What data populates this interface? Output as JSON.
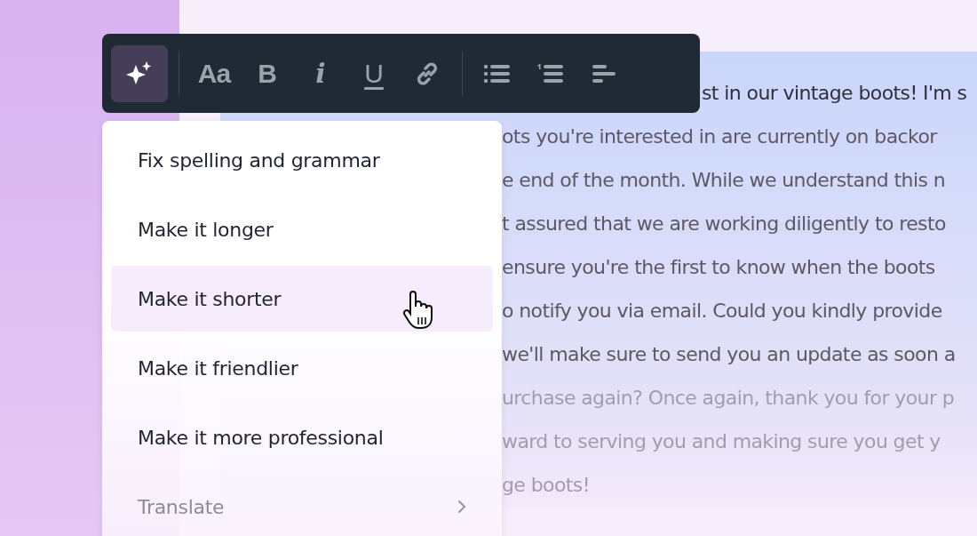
{
  "toolbar": {
    "items": [
      {
        "kind": "ai",
        "selected": true
      },
      {
        "kind": "text-style",
        "label": "Aa"
      },
      {
        "kind": "bold",
        "label": "B"
      },
      {
        "kind": "italic",
        "label": "i"
      },
      {
        "kind": "underline",
        "label": "U"
      },
      {
        "kind": "link"
      },
      {
        "kind": "divider"
      },
      {
        "kind": "bullet-list"
      },
      {
        "kind": "numbered-list"
      },
      {
        "kind": "align"
      }
    ]
  },
  "menu": {
    "items": [
      {
        "label": "Fix spelling and grammar",
        "selected": false,
        "submenu": false,
        "disabled": false
      },
      {
        "label": "Make it longer",
        "selected": false,
        "submenu": false,
        "disabled": false
      },
      {
        "label": "Make it shorter",
        "selected": true,
        "submenu": false,
        "disabled": false
      },
      {
        "label": "Make it friendlier",
        "selected": false,
        "submenu": false,
        "disabled": false
      },
      {
        "label": "Make it more professional",
        "selected": false,
        "submenu": false,
        "disabled": false
      },
      {
        "label": "Translate",
        "selected": false,
        "submenu": true,
        "disabled": true
      }
    ]
  },
  "document": {
    "lines": [
      "st in our vintage boots! I'm s",
      "ots you're interested in are currently on backor",
      "e end of the month. While we understand this n",
      "t assured that we are working diligently to resto",
      " ensure you're the first to know when the boots",
      "o notify you via email. Could you kindly provide",
      "we'll make sure to send you an update as soon a",
      "urchase again? Once again, thank you for your p",
      "ward to serving you and making sure you get y",
      "ge boots!"
    ]
  }
}
